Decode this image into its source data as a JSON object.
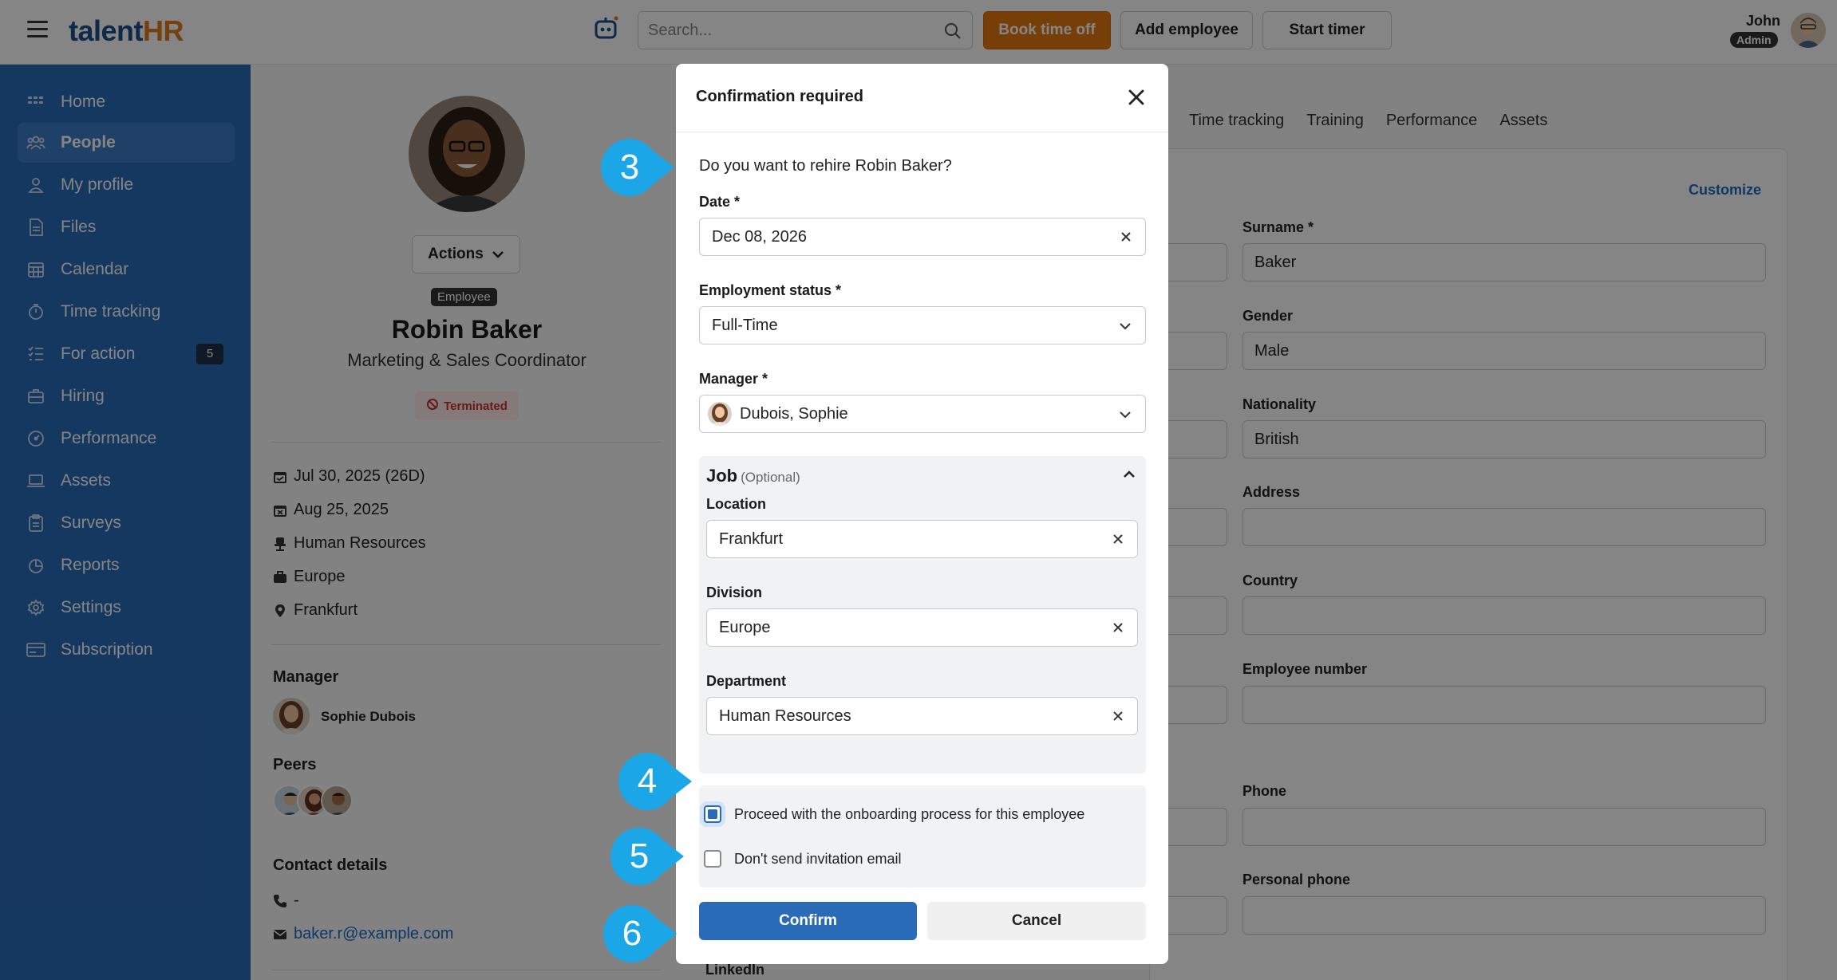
{
  "topbar": {
    "logo_main": "talent",
    "logo_accent": "HR",
    "search_placeholder": "Search...",
    "book_time_off": "Book time off",
    "add_employee": "Add employee",
    "start_timer": "Start timer",
    "user_name": "John",
    "user_role": "Admin"
  },
  "sidebar": {
    "items": [
      {
        "label": "Home",
        "icon": "home-icon"
      },
      {
        "label": "People",
        "icon": "people-icon"
      },
      {
        "label": "My profile",
        "icon": "user-icon"
      },
      {
        "label": "Files",
        "icon": "file-icon"
      },
      {
        "label": "Calendar",
        "icon": "calendar-icon"
      },
      {
        "label": "Time tracking",
        "icon": "stopwatch-icon"
      },
      {
        "label": "For action",
        "icon": "checklist-icon",
        "badge": "5"
      },
      {
        "label": "Hiring",
        "icon": "briefcase-icon"
      },
      {
        "label": "Performance",
        "icon": "gauge-icon"
      },
      {
        "label": "Assets",
        "icon": "laptop-icon"
      },
      {
        "label": "Surveys",
        "icon": "survey-icon"
      },
      {
        "label": "Reports",
        "icon": "pie-chart-icon"
      },
      {
        "label": "Settings",
        "icon": "gear-icon"
      },
      {
        "label": "Subscription",
        "icon": "card-icon"
      }
    ],
    "active_index": 1
  },
  "profile": {
    "actions_label": "Actions",
    "badge": "Employee",
    "name": "Robin Baker",
    "title": "Marketing & Sales Coordinator",
    "status": "Terminated",
    "start_date": "Jul 30, 2025 (26D)",
    "end_date": "Aug 25, 2025",
    "department": "Human Resources",
    "division": "Europe",
    "location": "Frankfurt",
    "manager_heading": "Manager",
    "manager_name": "Sophie Dubois",
    "peers_heading": "Peers",
    "contact_heading": "Contact details",
    "phone": "-",
    "email": "baker.r@example.com"
  },
  "background_form": {
    "tabs": [
      "Time tracking",
      "Training",
      "Performance",
      "Assets"
    ],
    "customize": "Customize",
    "fields": [
      {
        "label": "Surname *",
        "value": "Baker"
      },
      {
        "label": "Gender",
        "value": "Male"
      },
      {
        "label": "Nationality",
        "value": "British"
      },
      {
        "label": "Address",
        "value": ""
      },
      {
        "label": "Country",
        "value": ""
      },
      {
        "label": "Employee number",
        "value": ""
      },
      {
        "label": "Phone",
        "value": ""
      },
      {
        "label": "Personal phone",
        "value": ""
      }
    ],
    "linkedin": "LinkedIn"
  },
  "modal": {
    "title": "Confirmation required",
    "question": "Do you want to rehire Robin Baker?",
    "date_label": "Date *",
    "date_value": "Dec 08, 2026",
    "status_label": "Employment status *",
    "status_value": "Full-Time",
    "manager_label": "Manager *",
    "manager_value": "Dubois, Sophie",
    "job_title": "Job",
    "job_optional": "(Optional)",
    "location_label": "Location",
    "location_value": "Frankfurt",
    "division_label": "Division",
    "division_value": "Europe",
    "department_label": "Department",
    "department_value": "Human Resources",
    "onboarding_label": "Proceed with the onboarding process for this employee",
    "onboarding_checked": true,
    "no_invite_label": "Don't send invitation email",
    "no_invite_checked": false,
    "confirm": "Confirm",
    "cancel": "Cancel"
  },
  "callouts": [
    "3",
    "4",
    "5",
    "6"
  ],
  "colors": {
    "primary": "#2a6bb8",
    "sidebar": "#2a6bb8",
    "accent": "#e4780f",
    "danger": "#c9302c",
    "callout": "#1ba6e8"
  }
}
